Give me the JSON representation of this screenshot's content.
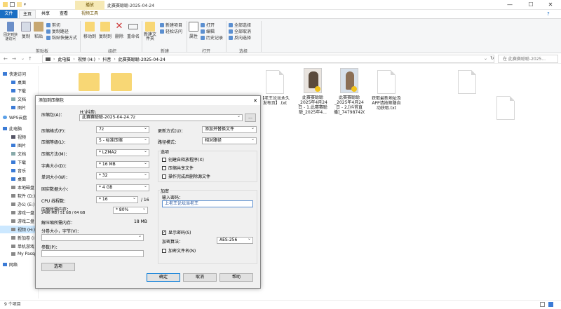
{
  "window": {
    "context_tab": "播放",
    "title": "此赛赛聪聪-2025-04-24",
    "minimize": "—",
    "maximize": "☐",
    "close": "✕"
  },
  "ribbon_tabs": [
    "文件",
    "主页",
    "共享",
    "查看",
    "视频工具"
  ],
  "ribbon": {
    "clipboard": {
      "pin": "固定到快速访问",
      "copy": "复制",
      "paste": "粘贴",
      "cut": "剪切",
      "copy_path": "复制路径",
      "paste_shortcut": "粘贴快捷方式",
      "label": "剪贴板"
    },
    "organize": {
      "move_to": "移动到",
      "copy_to": "复制到",
      "delete": "删除",
      "rename": "重命名",
      "label": "组织"
    },
    "new": {
      "new_folder": "新建文件夹",
      "new_item": "新建项目",
      "easy_access": "轻松访问",
      "label": "新建"
    },
    "open": {
      "properties": "属性",
      "open": "打开",
      "edit": "编辑",
      "history": "历史记录",
      "label": "打开"
    },
    "select": {
      "select_all": "全部选择",
      "select_none": "全部取消",
      "invert": "反向选择",
      "label": "选择"
    }
  },
  "address": {
    "crumbs": [
      "此电脑",
      "视频 (H:)",
      "抖音",
      "此赛赛聪聪-2025-04-24"
    ],
    "search_placeholder": "在 此赛赛聪聪-2025..."
  },
  "nav": {
    "items": [
      {
        "label": "快速访问"
      },
      {
        "label": "桌面"
      },
      {
        "label": "下载"
      },
      {
        "label": "文档"
      },
      {
        "label": "图片"
      },
      {
        "label": "WPS云盘"
      },
      {
        "label": "此电脑"
      },
      {
        "label": "视频"
      },
      {
        "label": "图片"
      },
      {
        "label": "文档"
      },
      {
        "label": "下载"
      },
      {
        "label": "音乐"
      },
      {
        "label": "桌面"
      },
      {
        "label": "本地磁盘"
      },
      {
        "label": "软件 (D:)"
      },
      {
        "label": "办公 (E:)"
      },
      {
        "label": "游戏一盘"
      },
      {
        "label": "游戏二盘"
      },
      {
        "label": "视频 (H:)"
      },
      {
        "label": "新加卷 (I"
      },
      {
        "label": "单机游戏"
      },
      {
        "label": "My Passp"
      },
      {
        "label": "网络"
      }
    ]
  },
  "files": [
    {
      "name": "【老王论坛永久发布页】.txt"
    },
    {
      "name": "此赛赛聪聪_2025年4月24日 - 1.此赛赛聪聪_2025年4..."
    },
    {
      "name": "此赛赛聪聪_2025年4月24日 - 2.[抖音直播]_7479874206..."
    },
    {
      "name": "获取最新地址及APP请按顺路自动获取.txt"
    }
  ],
  "status": {
    "count": "9 个项目"
  },
  "dialog": {
    "title": "添加到压缩包",
    "close": "✕",
    "archive_label": "压缩包(A)：",
    "archive_path": "H:\\抖音\\",
    "archive_name": "此赛赛聪聪-2025-04-24.7z",
    "browse": "...",
    "format_label": "压缩格式(F)：",
    "format_value": "7z",
    "level_label": "压缩等级(L)：",
    "level_value": "5 - 标准压缩",
    "method_label": "压缩方法(M)：",
    "method_value": "* LZMA2",
    "dict_label": "字典大小(D)：",
    "dict_value": "* 16 MB",
    "word_label": "单词大小(W)：",
    "word_value": "* 32",
    "solid_label": "固实数据大小：",
    "solid_value": "* 4 GB",
    "cpu_label": "CPU 线程数：",
    "cpu_value": "* 16",
    "cpu_total": "/ 16",
    "mem_label": "压缩所需内存：",
    "mem_detail": "2496 MB / 51 GB / 64 GB",
    "mem_value": "* 80%",
    "decomp_label": "解压缩所需内存：",
    "decomp_value": "18 MB",
    "split_label": "分卷大小，字节(V)：",
    "params_label": "参数(P)：",
    "options_btn": "选项",
    "update_label": "更新方式(U)：",
    "update_value": "添加并替换文件",
    "path_label": "路径模式：",
    "path_value": "相对路径",
    "options_group": "选项",
    "opt_sfx": "创建自释放程序(X)",
    "opt_shared": "压缩共享文件",
    "opt_delete": "操作完成后删除源文件",
    "encrypt_group": "加密",
    "password_label": "输入密码：",
    "password_value": "上老王论坛当老王",
    "show_password": "显示密码(S)",
    "enc_method_label": "加密算法：",
    "enc_method_value": "AES-256",
    "encrypt_names": "加密文件名(N)",
    "ok": "确定",
    "cancel": "取消",
    "help": "帮助"
  }
}
